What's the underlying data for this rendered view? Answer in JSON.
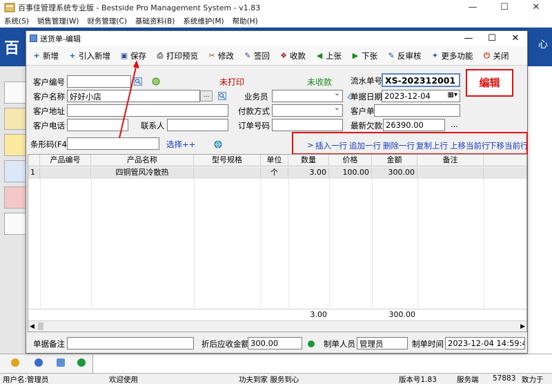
{
  "main_window": {
    "title": "百事佳管理系统专业版 - Bestside Pro Management System - v1.83",
    "min": "—",
    "max": "☐",
    "close": "✕",
    "menu": [
      "系统(S)",
      "销售管理(W)",
      "财务管理(C)",
      "基础资料(B)",
      "系统维护(M)",
      "帮助(H)"
    ],
    "banner_left": "百",
    "banner_right": "心"
  },
  "dialog": {
    "title": "送货单-编辑",
    "min": "—",
    "max": "☐",
    "close": "✕"
  },
  "toolbar": [
    {
      "name": "new",
      "label": "新增",
      "icon": "+",
      "color": "#1e5fbf"
    },
    {
      "name": "import-new",
      "label": "引入新增",
      "icon": "+",
      "color": "#1e5fbf"
    },
    {
      "name": "save",
      "label": "保存",
      "icon": "▣",
      "color": "#2b4f9a"
    },
    {
      "name": "print-preview",
      "label": "打印预览",
      "icon": "⎙",
      "color": "#555"
    },
    {
      "name": "modify",
      "label": "修改",
      "icon": "✂",
      "color": "#8a5a00"
    },
    {
      "name": "sign-back",
      "label": "签回",
      "icon": "✎",
      "color": "#3a3aa0"
    },
    {
      "name": "collect",
      "label": "收款",
      "icon": "❖",
      "color": "#b02020"
    },
    {
      "name": "prev",
      "label": "上张",
      "icon": "◀",
      "color": "#1a8a1a"
    },
    {
      "name": "next",
      "label": "下张",
      "icon": "▶",
      "color": "#1a8a1a"
    },
    {
      "name": "unaudit",
      "label": "反审核",
      "icon": "✎",
      "color": "#2b4f9a"
    },
    {
      "name": "more",
      "label": "更多功能",
      "icon": "✦",
      "color": "#1e5fbf"
    },
    {
      "name": "close",
      "label": "关闭",
      "icon": "⏻",
      "color": "#c03010"
    }
  ],
  "form": {
    "customer_code_label": "客户编号",
    "customer_code": "",
    "customer_name_label": "客户名称",
    "customer_name": "好好小店",
    "ellipsis": "...",
    "customer_addr_label": "客户地址",
    "customer_addr": "",
    "customer_phone_label": "客户电话",
    "customer_phone": "",
    "contact_label": "联系人",
    "contact": "",
    "salesman_label": "业务员",
    "salesman": "",
    "pay_method_label": "付款方式",
    "pay_method": "",
    "order_no_label": "订单号码",
    "order_no": "",
    "print_status": "未打印",
    "collect_status": "未收款",
    "serial_label": "流水单号",
    "serial": "XS-202312001",
    "date_label": "单据日期",
    "date": "2023-12-04",
    "cust_doc_label": "客户单号",
    "cust_doc": "",
    "latest_debt_label": "最新欠款",
    "latest_debt": "26390.00",
    "barcode_label": "条形码(F4)",
    "barcode": "",
    "choose": "选择++",
    "edit_badge": "编辑"
  },
  "row_ops": {
    "arrow": ">",
    "insert": "插入一行",
    "append": "追加一行",
    "delete": "删除一行",
    "copy": "复制上行",
    "move_up": "上移当前行",
    "move_down": "下移当前行"
  },
  "grid": {
    "columns": [
      "",
      "产品编号",
      "产品名称",
      "型号规格",
      "单位",
      "数量",
      "价格",
      "金额",
      "备注"
    ],
    "rows": [
      [
        "1",
        "",
        "四铜管风冷散热",
        "",
        "个",
        "3.00",
        "100.00",
        "300.00",
        ""
      ]
    ],
    "totals": {
      "qty": "3.00",
      "amount": "300.00"
    }
  },
  "bottom": {
    "remark_label": "单据备注",
    "remark": "",
    "discount_label": "折后应收金额",
    "discount": "300.00",
    "maker_label": "制单人员",
    "maker": "管理员",
    "make_time_label": "制单时间",
    "make_time": "2023-12-04 14:59:41"
  },
  "status_bar": {
    "user": "用户名:管理员",
    "welcome": "欢迎使用",
    "slogan": "功夫到家 服务到心",
    "version": "版本号1.83",
    "server": "服务端",
    "port": "57883",
    "devoted": "致力于"
  },
  "colors": {
    "accent_blue": "#1a4fa0",
    "red_highlight": "#e01010",
    "link": "#1a3fbf",
    "status_red": "#c00000",
    "status_green": "#1a8a1a"
  }
}
